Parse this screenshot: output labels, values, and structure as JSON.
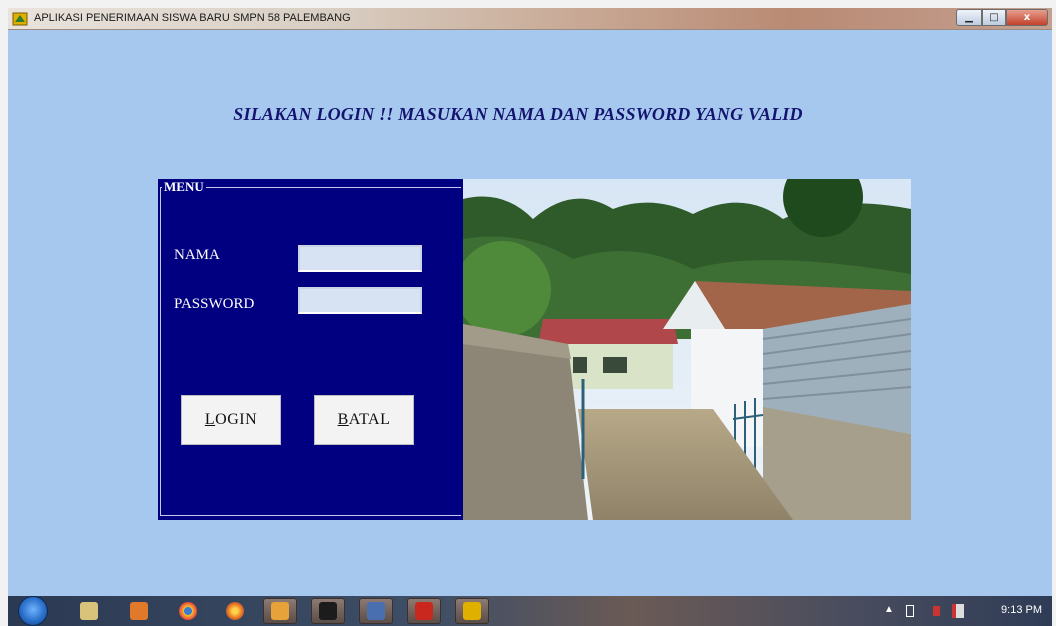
{
  "window": {
    "title": "APLIKASI PENERIMAAN SISWA BARU SMPN 58 PALEMBANG",
    "min_glyph": "▁",
    "max_glyph": "□",
    "close_glyph": "x"
  },
  "form": {
    "heading": "SILAKAN LOGIN !! MASUKAN NAMA DAN PASSWORD YANG VALID",
    "frame_caption": "MENU",
    "nama_label": "NAMA",
    "password_label": "PASSWORD",
    "nama_value": "",
    "password_value": "",
    "login_button": {
      "first": "L",
      "rest": "OGIN"
    },
    "batal_button": {
      "first": "B",
      "rest": "ATAL"
    },
    "panel_color": "#000080",
    "background_color": "#a6c8ef"
  },
  "taskbar": {
    "icons": [
      "start-orb-icon",
      "folder-icon",
      "media-player-icon",
      "chrome-icon",
      "firefox-icon",
      "app-icon",
      "seven-zip-icon",
      "visual-basic-icon",
      "pdf-icon",
      "form-app-icon"
    ],
    "clock": "9:13 PM"
  }
}
